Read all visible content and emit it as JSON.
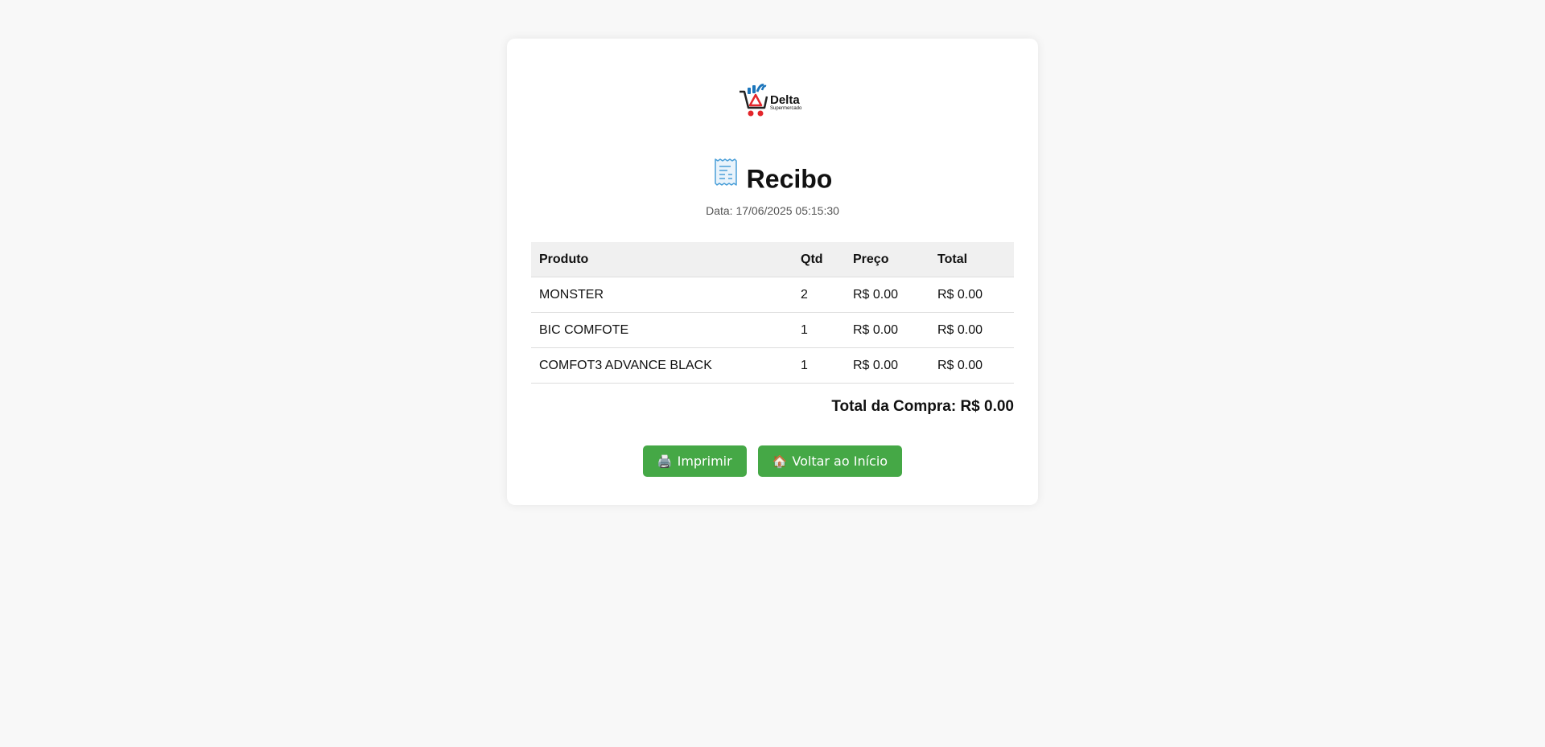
{
  "brand": {
    "name": "Delta",
    "tagline": "Supermercado"
  },
  "receipt": {
    "title": "Recibo",
    "date_text": "Data: 17/06/2025 05:15:30"
  },
  "table": {
    "headers": [
      "Produto",
      "Qtd",
      "Preço",
      "Total"
    ],
    "rows": [
      {
        "produto": "MONSTER",
        "qtd": "2",
        "preco": "R$ 0.00",
        "total": "R$ 0.00"
      },
      {
        "produto": "BIC COMFOTE",
        "qtd": "1",
        "preco": "R$ 0.00",
        "total": "R$ 0.00"
      },
      {
        "produto": "COMFOT3 ADVANCE BLACK",
        "qtd": "1",
        "preco": "R$ 0.00",
        "total": "R$ 0.00"
      }
    ]
  },
  "total_text": "Total da Compra: R$ 0.00",
  "actions": {
    "print_label": "Imprimir",
    "home_label": "Voltar ao Início"
  },
  "icons": {
    "logo": "shopping-cart-logo-icon",
    "receipt": "receipt-icon",
    "print": "printer-icon",
    "home": "house-icon"
  },
  "colors": {
    "button_bg": "#45a846",
    "page_bg": "#f8f8f8",
    "logo_red": "#e3262b",
    "logo_blue": "#1b75bb"
  }
}
